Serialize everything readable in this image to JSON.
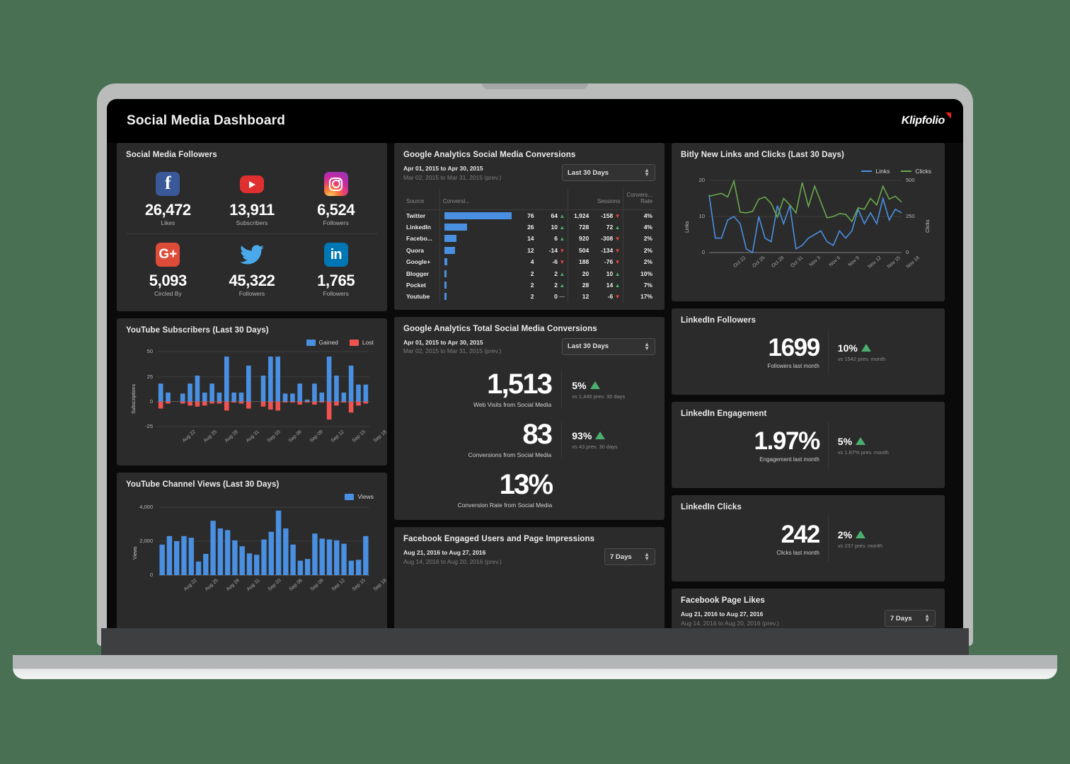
{
  "header": {
    "title": "Social Media Dashboard",
    "brand": "Klipfolio",
    "brand_accent_color": "#e2231a"
  },
  "colors": {
    "blue": "#4a90e2",
    "green": "#6aa84f",
    "red": "#e8453c",
    "up_green": "#4caf6d",
    "panel": "#2b2b2b",
    "screen": "#0a0a0a"
  },
  "followers": {
    "title": "Social Media Followers",
    "items": [
      {
        "icon": "facebook-icon",
        "value": "26,472",
        "label": "Likes"
      },
      {
        "icon": "youtube-icon",
        "value": "13,911",
        "label": "Subscribers"
      },
      {
        "icon": "instagram-icon",
        "value": "6,524",
        "label": "Followers"
      },
      {
        "icon": "googleplus-icon",
        "value": "5,093",
        "label": "Circled By"
      },
      {
        "icon": "twitter-icon",
        "value": "45,322",
        "label": "Followers"
      },
      {
        "icon": "linkedin-icon",
        "value": "1,765",
        "label": "Followers"
      }
    ]
  },
  "ga_conversions": {
    "title": "Google Analytics Social Media Conversions",
    "date_current": "Apr 01, 2015 to Apr 30, 2015",
    "date_previous": "Mar 02, 2015 to Mar 31, 2015 (prev.)",
    "select_value": "Last 30 Days",
    "columns": [
      "Source",
      "Conversi...",
      "Sessions",
      "Convers... Rate"
    ],
    "col_sessions": "Sessions",
    "col_rate_line1": "Convers...",
    "col_rate_line2": "Rate",
    "rows": [
      {
        "source": "Twitter",
        "conversions": "76",
        "bar_pct": 100,
        "conv_delta": "64",
        "conv_dir": "up",
        "sessions": "1,924",
        "sess_delta": "-158",
        "sess_dir": "down",
        "rate": "4%"
      },
      {
        "source": "LinkedIn",
        "conversions": "26",
        "bar_pct": 34,
        "conv_delta": "10",
        "conv_dir": "up",
        "sessions": "728",
        "sess_delta": "72",
        "sess_dir": "up",
        "rate": "4%"
      },
      {
        "source": "Facebo...",
        "conversions": "14",
        "bar_pct": 18,
        "conv_delta": "6",
        "conv_dir": "up",
        "sessions": "920",
        "sess_delta": "-308",
        "sess_dir": "down",
        "rate": "2%"
      },
      {
        "source": "Quora",
        "conversions": "12",
        "bar_pct": 16,
        "conv_delta": "-14",
        "conv_dir": "down",
        "sessions": "504",
        "sess_delta": "-134",
        "sess_dir": "down",
        "rate": "2%"
      },
      {
        "source": "Google+",
        "conversions": "4",
        "bar_pct": 5,
        "conv_delta": "-6",
        "conv_dir": "down",
        "sessions": "188",
        "sess_delta": "-76",
        "sess_dir": "down",
        "rate": "2%"
      },
      {
        "source": "Blogger",
        "conversions": "2",
        "bar_pct": 3,
        "conv_delta": "2",
        "conv_dir": "up",
        "sessions": "20",
        "sess_delta": "10",
        "sess_dir": "up",
        "rate": "10%"
      },
      {
        "source": "Pocket",
        "conversions": "2",
        "bar_pct": 3,
        "conv_delta": "2",
        "conv_dir": "up",
        "sessions": "28",
        "sess_delta": "14",
        "sess_dir": "up",
        "rate": "7%"
      },
      {
        "source": "Youtube",
        "conversions": "2",
        "bar_pct": 3,
        "conv_delta": "0",
        "conv_dir": "flat",
        "sessions": "12",
        "sess_delta": "-6",
        "sess_dir": "down",
        "rate": "17%"
      }
    ]
  },
  "ga_total": {
    "title": "Google Analytics Total Social Media Conversions",
    "date_current": "Apr 01, 2015 to Apr 30, 2015",
    "date_previous": "Mar 02, 2015 to Mar 31, 2015 (prev.)",
    "select_value": "Last 30 Days",
    "stats": [
      {
        "value": "1,513",
        "label": "Web Visits from Social Media",
        "pct": "5%",
        "dir": "up",
        "sub": "vs 1,446 prev. 30 days"
      },
      {
        "value": "83",
        "label": "Conversions from Social Media",
        "pct": "93%",
        "dir": "up",
        "sub": "vs 43 prev. 30 days"
      },
      {
        "value": "13%",
        "label": "Conversion Rate from Social Media",
        "pct": "",
        "dir": "",
        "sub": ""
      }
    ]
  },
  "fb_engaged": {
    "title": "Facebook Engaged Users and Page Impressions",
    "date_current": "Aug 21, 2016 to Aug 27, 2016",
    "date_previous": "Aug 14, 2016 to Aug 20, 2016 (prev.)",
    "select_value": "7 Days"
  },
  "fb_likes": {
    "title": "Facebook Page Likes",
    "date_current": "Aug 21, 2016 to Aug 27, 2016",
    "date_previous": "Aug 14, 2016 to Aug 20, 2016 (prev.)",
    "select_value": "7 Days"
  },
  "linkedin_followers": {
    "title": "LinkedIn Followers",
    "value": "1699",
    "label": "Followers last month",
    "pct": "10%",
    "dir": "up",
    "sub": "vs 1542 prev. month"
  },
  "linkedin_engagement": {
    "title": "LinkedIn Engagement",
    "value": "1.97%",
    "label": "Engagement last month",
    "pct": "5%",
    "dir": "up",
    "sub": "vs 1.87% prev. month"
  },
  "linkedin_clicks": {
    "title": "LinkedIn Clicks",
    "value": "242",
    "label": "Clicks last month",
    "pct": "2%",
    "dir": "up",
    "sub": "vs 237 prev. month"
  },
  "chart_data": [
    {
      "id": "bitly",
      "type": "line",
      "title": "Bitly New Links and Clicks (Last 30 Days)",
      "legend": [
        {
          "name": "Links",
          "color": "#4a90e2",
          "position": "top-right"
        },
        {
          "name": "Clicks",
          "color": "#6aa84f",
          "position": "top-right"
        }
      ],
      "xlabel": "",
      "ylabel": "Links",
      "y2label": "Clicks",
      "ylim": [
        0,
        20
      ],
      "y2lim": [
        0,
        500
      ],
      "yticks": [
        "0",
        "10",
        "20"
      ],
      "y2ticks": [
        "0",
        "250",
        "500"
      ],
      "xticklabels": [
        "Oct 22",
        "Oct 25",
        "Oct 28",
        "Oct 31",
        "Nov 3",
        "Nov 6",
        "Nov 9",
        "Nov 12",
        "Nov 15",
        "Nov 18"
      ],
      "grid": true,
      "series": [
        {
          "name": "Links",
          "color": "#4a90e2",
          "values": [
            16,
            4,
            4,
            9,
            10,
            8,
            1,
            0,
            10,
            4,
            3,
            13,
            8,
            13,
            1,
            2,
            4,
            5,
            6,
            3,
            2,
            6,
            4,
            6,
            12,
            8,
            11,
            8,
            15,
            9,
            12,
            11
          ]
        },
        {
          "name": "Clicks",
          "color": "#6aa84f",
          "values": [
            390,
            400,
            410,
            385,
            495,
            280,
            275,
            285,
            370,
            385,
            340,
            245,
            375,
            330,
            275,
            485,
            320,
            460,
            350,
            240,
            250,
            270,
            265,
            215,
            310,
            300,
            375,
            330,
            460,
            370,
            390,
            350
          ]
        }
      ]
    },
    {
      "id": "youtube-subscribers",
      "type": "bar",
      "title": "YouTube Subscribers (Last 30 Days)",
      "legend": [
        {
          "name": "Gained",
          "color": "#4a90e2"
        },
        {
          "name": "Lost",
          "color": "#ef5350"
        }
      ],
      "ylabel": "Subscriptions",
      "ylim": [
        -25,
        50
      ],
      "yticks": [
        "-25",
        "0",
        "25",
        "50"
      ],
      "xticklabels": [
        "Aug 22",
        "Aug 25",
        "Aug 28",
        "Aug 31",
        "Sep 03",
        "Sep 06",
        "Sep 09",
        "Sep 12",
        "Sep 15",
        "Sep 18"
      ],
      "grid": true,
      "series": [
        {
          "name": "Gained",
          "color": "#4a90e2",
          "values": [
            18,
            9,
            0,
            8,
            18,
            26,
            9,
            18,
            9,
            45,
            9,
            9,
            36,
            0,
            26,
            45,
            45,
            8,
            8,
            18,
            2,
            18,
            9,
            45,
            26,
            9,
            36,
            17,
            17
          ]
        },
        {
          "name": "Lost",
          "color": "#ef5350",
          "values": [
            -7,
            -2,
            0,
            -2,
            -4,
            -5,
            -4,
            -2,
            -2,
            -9,
            -1,
            -2,
            -7,
            0,
            -5,
            -8,
            -9,
            -1,
            -1,
            -3,
            -1,
            -3,
            -1,
            -18,
            -4,
            -1,
            -11,
            -4,
            -2
          ]
        }
      ]
    },
    {
      "id": "youtube-channel-views",
      "type": "bar",
      "title": "YouTube Channel Views (Last 30 Days)",
      "legend": [
        {
          "name": "Views",
          "color": "#4a90e2"
        }
      ],
      "ylabel": "Views",
      "ylim": [
        0,
        4000
      ],
      "yticks": [
        "0",
        "2,000",
        "4,000"
      ],
      "xticklabels": [
        "Aug 22",
        "Aug 25",
        "Aug 28",
        "Aug 31",
        "Sep 03",
        "Sep 06",
        "Sep 09",
        "Sep 12",
        "Sep 15",
        "Sep 18"
      ],
      "grid": true,
      "series": [
        {
          "name": "Views",
          "color": "#4a90e2",
          "values": [
            1800,
            2300,
            2000,
            2300,
            2200,
            800,
            1250,
            3200,
            2750,
            2650,
            2050,
            1700,
            1280,
            1200,
            2100,
            2550,
            3800,
            2750,
            1800,
            850,
            950,
            2450,
            2150,
            2100,
            2050,
            1850,
            850,
            900,
            2300
          ]
        }
      ]
    }
  ]
}
